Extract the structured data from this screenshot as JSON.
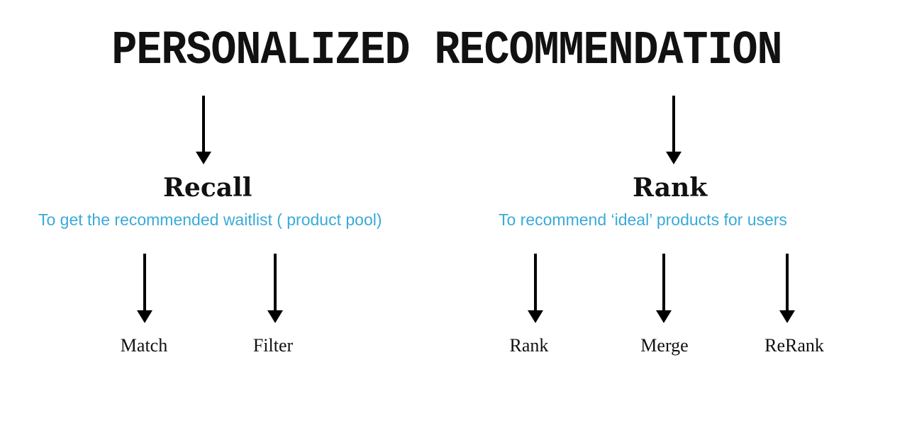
{
  "title": "PERSONALIZED RECOMMENDATION",
  "recall": {
    "heading": "Recall",
    "subtitle": "To get the recommended waitlist ( product pool)",
    "children": [
      "Match",
      "Filter"
    ]
  },
  "rank": {
    "heading": "Rank",
    "subtitle": "To recommend ‘ideal’ products for users",
    "children": [
      "Rank",
      "Merge",
      "ReRank"
    ]
  }
}
